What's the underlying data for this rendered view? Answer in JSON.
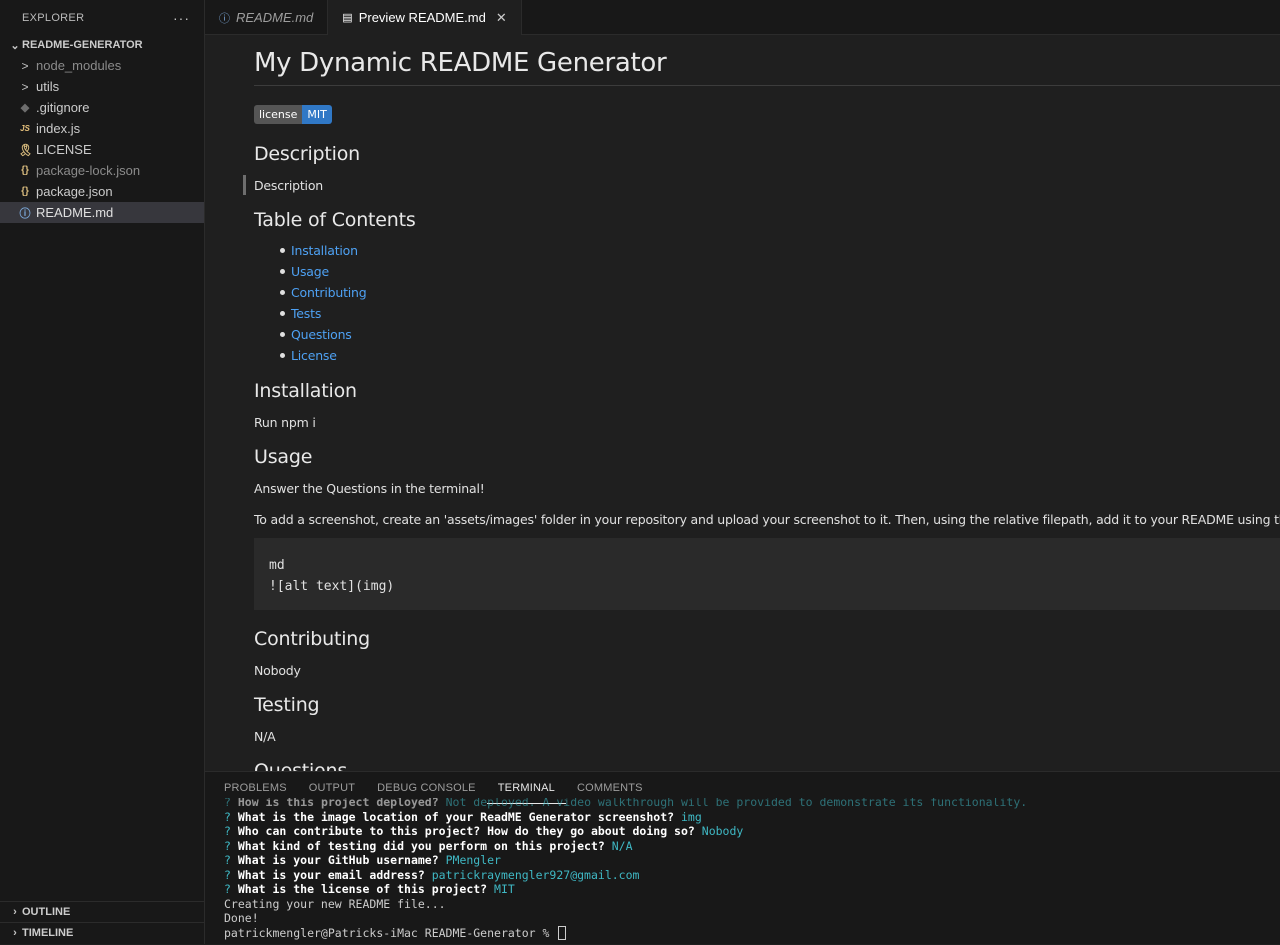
{
  "sidebar": {
    "title": "EXPLORER",
    "more": "···",
    "folder": "README-GENERATOR",
    "items": [
      {
        "label": "node_modules",
        "icon": "chevron-right-icon",
        "glyph": ">",
        "dim": true
      },
      {
        "label": "utils",
        "icon": "chevron-right-icon",
        "glyph": ">",
        "dim": false
      },
      {
        "label": ".gitignore",
        "icon": "git-icon",
        "glyph": "◆",
        "dim": false
      },
      {
        "label": "index.js",
        "icon": "javascript-icon",
        "glyph": "JS",
        "dim": false
      },
      {
        "label": "LICENSE",
        "icon": "license-icon",
        "glyph": "🎗",
        "dim": false
      },
      {
        "label": "package-lock.json",
        "icon": "json-icon",
        "glyph": "{}",
        "dim": true
      },
      {
        "label": "package.json",
        "icon": "json-icon",
        "glyph": "{}",
        "dim": false
      },
      {
        "label": "README.md",
        "icon": "info-icon",
        "glyph": "ⓘ",
        "dim": false,
        "selected": true
      }
    ],
    "outline": "OUTLINE",
    "timeline": "TIMELINE"
  },
  "tabs": [
    {
      "label": "README.md",
      "active": false
    },
    {
      "label": "Preview README.md",
      "active": true
    }
  ],
  "preview": {
    "title": "My Dynamic README Generator",
    "badge": {
      "left": "license",
      "right": "MIT"
    },
    "sections": {
      "description_heading": "Description",
      "description_text": "Description",
      "toc_heading": "Table of Contents",
      "toc": [
        "Installation",
        "Usage",
        "Contributing",
        "Tests",
        "Questions",
        "License"
      ],
      "installation_heading": "Installation",
      "installation_text": "Run npm i",
      "usage_heading": "Usage",
      "usage_text_1": "Answer the Questions in the terminal!",
      "usage_text_2": "To add a screenshot, create an 'assets/images' folder in your repository and upload your screenshot to it. Then, using the relative filepath, add it to your README using the following syntax:",
      "code_line_1": "md",
      "code_line_2": "![alt text](img)",
      "contributing_heading": "Contributing",
      "contributing_text": "Nobody",
      "testing_heading": "Testing",
      "testing_text": "N/A",
      "questions_heading": "Questions"
    }
  },
  "panel": {
    "tabs": [
      "PROBLEMS",
      "OUTPUT",
      "DEBUG CONSOLE",
      "TERMINAL",
      "COMMENTS"
    ],
    "active_tab": "TERMINAL",
    "terminal": {
      "cut_line": {
        "q": "How is this project deployed?",
        "a": "Not deployed. A video walkthrough will be provided to demonstrate its functionality."
      },
      "qa": [
        {
          "q": "What is the image location of your ReadME Generator screenshot?",
          "a": "img"
        },
        {
          "q": "Who can contribute to this project? How do they go about doing so?",
          "a": "Nobody"
        },
        {
          "q": "What kind of testing did you perform on this project?",
          "a": "N/A"
        },
        {
          "q": "What is your GitHub username?",
          "a": "PMengler"
        },
        {
          "q": "What is your email address?",
          "a": "patrickraymengler927@gmail.com"
        },
        {
          "q": "What is the license of this project?",
          "a": "MIT"
        }
      ],
      "creating": "Creating your new README file...",
      "done": "Done!",
      "prompt": "patrickmengler@Patricks-iMac README-Generator % "
    }
  }
}
